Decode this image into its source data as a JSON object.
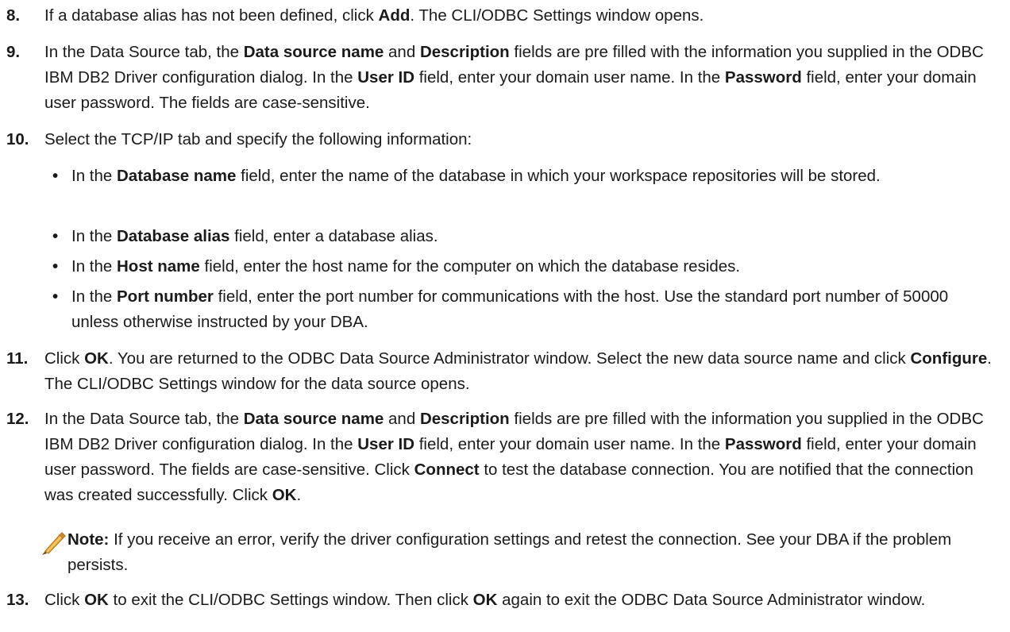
{
  "steps": {
    "s8": {
      "num": "8.",
      "parts": [
        "If a database alias has not been defined, click ",
        "Add",
        ". The CLI/ODBC Settings window opens."
      ]
    },
    "s9": {
      "num": "9.",
      "parts": [
        "In the Data Source tab, the ",
        "Data source name",
        " and ",
        "Description",
        " fields are pre filled with the information you supplied in the ODBC IBM DB2 Driver configuration dialog. In the ",
        "User ID",
        " field, enter your domain user name. In the ",
        "Password",
        " field, enter your domain user password. The fields are case-sensitive."
      ]
    },
    "s10": {
      "num": "10.",
      "parts": [
        "Select the TCP/IP tab and specify the following information:"
      ]
    },
    "s11": {
      "num": "11.",
      "parts": [
        "Click ",
        "OK",
        ". You are returned to the ODBC Data Source Administrator window. Select the new data source name and click ",
        "Configure",
        ". The CLI/ODBC Settings window for the data source opens."
      ]
    },
    "s12": {
      "num": "12.",
      "parts": [
        "In the Data Source tab, the ",
        "Data source name",
        " and ",
        "Description",
        " fields are pre filled with the information you supplied in the ODBC IBM DB2 Driver configuration dialog. In the ",
        "User ID",
        " field, enter your domain user name. In the ",
        "Password",
        " field, enter your domain user password. The fields are case-sensitive. Click ",
        "Connect",
        " to test the database connection. You are notified that the connection was created successfully. Click ",
        "OK",
        "."
      ]
    },
    "s13": {
      "num": "13.",
      "parts": [
        "Click ",
        "OK",
        " to exit the CLI/ODBC Settings window. Then click ",
        "OK",
        " again to exit the ODBC Data Source Administrator window."
      ]
    }
  },
  "bullets": [
    {
      "parts": [
        "In the ",
        "Database name",
        " field, enter the name of the database in which your workspace repositories will be stored."
      ]
    },
    {
      "parts": [
        "In the ",
        "Database alias",
        " field, enter a database alias."
      ]
    },
    {
      "parts": [
        "In the ",
        "Host name",
        " field, enter the host name for the computer on which the database resides."
      ]
    },
    {
      "parts": [
        "In the ",
        "Port number",
        " field, enter the port number for communications with the host. Use the standard port number of 50000 unless otherwise instructed by your DBA."
      ]
    }
  ],
  "bullet_symbol": "•",
  "note": {
    "label": "Note:",
    "text": " If you receive an error, verify the driver configuration settings and retest the connection. See your DBA if the problem persists.",
    "icon": "pencil-icon",
    "icon_color": "#e9a23b"
  }
}
